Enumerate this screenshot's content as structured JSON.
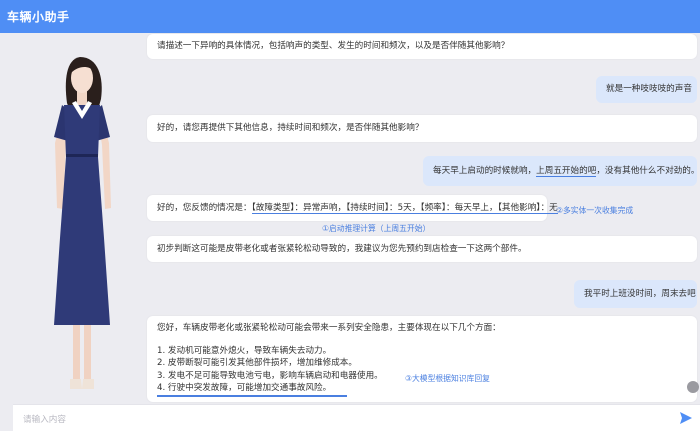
{
  "header": {
    "title": "车辆小助手"
  },
  "messages": [
    {
      "role": "bot",
      "text": "请描述一下异响的具体情况，包括响声的类型、发生的时间和频次，以及是否伴随其他影响？"
    },
    {
      "role": "user",
      "text": "就是一种吱吱吱的声音"
    },
    {
      "role": "bot",
      "text": "好的，请您再提供下其他信息，持续时间和频次，是否伴随其他影响？"
    },
    {
      "role": "user",
      "text_pre": "每天早上启动的时候就响，",
      "text_mark": "上周五开始的吧",
      "text_post": "，没有其他什么不对劲的。"
    },
    {
      "role": "bot",
      "text_pre": "好的，您反馈的情况是：",
      "text_mark": "【故障类型】：异常声响，【持续时间】：5天，【频率】：每天早上，【其他影响】：无"
    },
    {
      "role": "bot",
      "text": "初步判断这可能是皮带老化或者张紧轮松动导致的，我建议为您先预约到店检查一下这两个部件。"
    },
    {
      "role": "user",
      "text": "我平时上班没时间，周末去吧"
    },
    {
      "role": "bot",
      "intro": "您好，车辆皮带老化或张紧轮松动可能会带来一系列安全隐患，主要体现在以下几个方面：",
      "items": [
        "1. 发动机可能意外熄火，导致车辆失去动力。",
        "2. 皮带断裂可能引发其他部件损坏，增加维修成本。",
        "3. 发电不足可能导致电池亏电，影响车辆启动和电器使用。",
        "4. 行驶中突发故障，可能增加交通事故风险。"
      ]
    }
  ],
  "annotations": {
    "a1": "①启动推理计算（上周五开始）",
    "a2": "②多实体一次收集完成",
    "a3": "③大模型根据知识库回复"
  },
  "input": {
    "placeholder": "请输入内容"
  },
  "icons": {
    "send": "send-icon"
  },
  "colors": {
    "header": "#4f8ef5",
    "user_bubble": "#dbe7fb",
    "annotation": "#4a7fe0"
  }
}
